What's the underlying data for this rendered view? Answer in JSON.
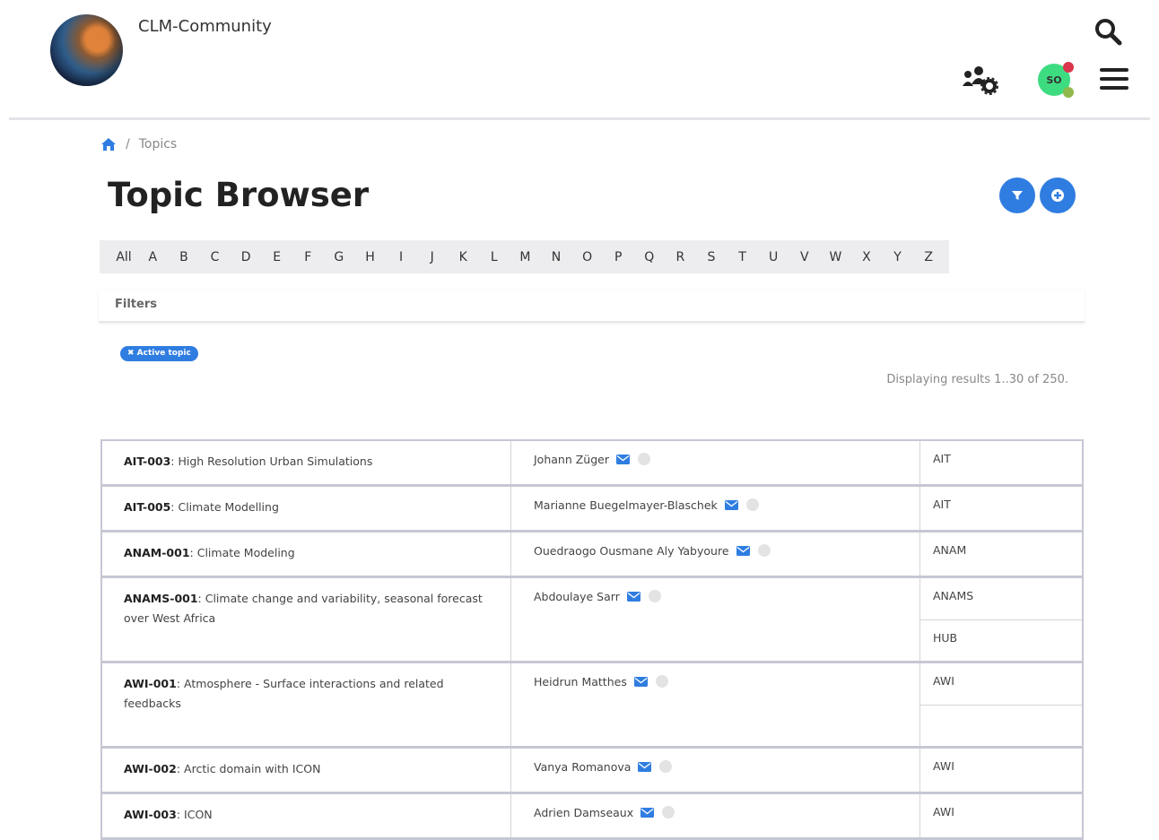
{
  "header": {
    "site_title": "CLM-Community",
    "avatar_initials": "SO",
    "accent_color": "#2f7de1"
  },
  "breadcrumb": {
    "separator": "/",
    "current": "Topics"
  },
  "page_title": "Topic Browser",
  "letters": [
    "All",
    "A",
    "B",
    "C",
    "D",
    "E",
    "F",
    "G",
    "H",
    "I",
    "J",
    "K",
    "L",
    "M",
    "N",
    "O",
    "P",
    "Q",
    "R",
    "S",
    "T",
    "U",
    "V",
    "W",
    "X",
    "Y",
    "Z"
  ],
  "filters_label": "Filters",
  "active_filter_chip": "✖ Active topic",
  "result_count": "Displaying results 1..30 of 250.",
  "topics": [
    {
      "code": "AIT-003",
      "title": ": High Resolution Urban Simulations",
      "person": "Johann Züger",
      "groups": [
        "AIT"
      ]
    },
    {
      "code": "AIT-005",
      "title": ": Climate Modelling",
      "person": "Marianne Buegelmayer-Blaschek",
      "groups": [
        "AIT"
      ]
    },
    {
      "code": "ANAM-001",
      "title": ": Climate Modeling",
      "person": "Ouedraogo Ousmane Aly Yabyoure",
      "groups": [
        "ANAM"
      ]
    },
    {
      "code": "ANAMS-001",
      "title": ": Climate change and variability, seasonal forecast over West Africa",
      "person": "Abdoulaye Sarr",
      "groups": [
        "ANAMS",
        "HUB"
      ]
    },
    {
      "code": "AWI-001",
      "title": ": Atmosphere - Surface interactions and related feedbacks",
      "person": "Heidrun Matthes",
      "groups": [
        "AWI",
        ""
      ]
    },
    {
      "code": "AWI-002",
      "title": ": Arctic domain with ICON",
      "person": "Vanya Romanova",
      "groups": [
        "AWI"
      ]
    },
    {
      "code": "AWI-003",
      "title": ": ICON",
      "person": "Adrien Damseaux",
      "groups": [
        "AWI"
      ]
    }
  ]
}
